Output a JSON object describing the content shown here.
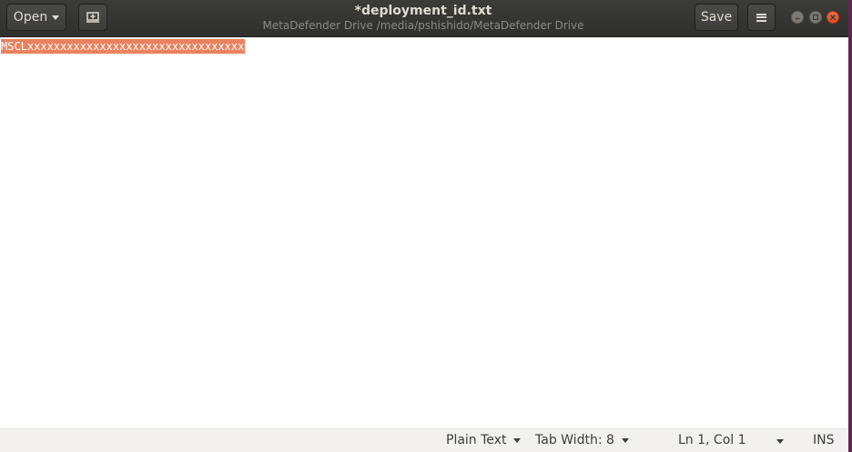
{
  "header": {
    "open_label": "Open",
    "title": "*deployment_id.txt",
    "subtitle": "MetaDefender Drive /media/pshishido/MetaDefender Drive",
    "save_label": "Save",
    "icons": [
      "new-tab-icon",
      "hamburger-menu-icon",
      "minimize-icon",
      "maximize-icon",
      "close-icon"
    ]
  },
  "editor": {
    "line1": "MSCLxxxxxxxxxxxxxxxxxxxxxxxxxxxxxxxxx",
    "selection_color": "#e9825f"
  },
  "statusbar": {
    "language": "Plain Text",
    "tab_width": "Tab Width: 8",
    "position": "Ln 1, Col 1",
    "mode": "INS"
  },
  "colors": {
    "headerbar": "#3b3b38",
    "close_button": "#e95420",
    "desktop": "#5e2750"
  }
}
